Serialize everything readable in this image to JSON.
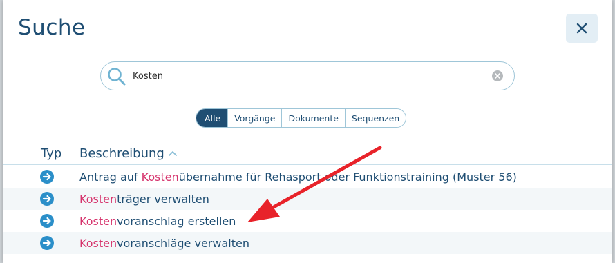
{
  "dialog": {
    "title": "Suche",
    "close_icon": "close-icon"
  },
  "search": {
    "value": "Kosten",
    "search_icon": "search-icon",
    "clear_icon": "clear-icon"
  },
  "filters": [
    {
      "label": "Alle",
      "active": true
    },
    {
      "label": "Vorgänge",
      "active": false
    },
    {
      "label": "Dokumente",
      "active": false
    },
    {
      "label": "Sequenzen",
      "active": false
    }
  ],
  "table": {
    "columns": [
      "Typ",
      "Beschreibung"
    ],
    "sort_icon": "chevron-up-icon",
    "highlight": "Kosten",
    "rows": [
      {
        "icon": "arrow-right-circle-icon",
        "match": "Kosten",
        "rest": "übernahme für Rehasport oder Funktionstraining (Muster 56)",
        "prefix": "Antrag auf "
      },
      {
        "icon": "arrow-right-circle-icon",
        "match": "Kosten",
        "rest": "träger verwalten",
        "prefix": ""
      },
      {
        "icon": "arrow-right-circle-icon",
        "match": "Kosten",
        "rest": "voranschlag erstellen",
        "prefix": ""
      },
      {
        "icon": "arrow-right-circle-icon",
        "match": "Kosten",
        "rest": "voranschläge verwalten",
        "prefix": ""
      }
    ]
  },
  "colors": {
    "primary": "#1f4e73",
    "highlight": "#d6336c",
    "row_icon": "#2b8fc9",
    "annotation_arrow": "#e8232a"
  }
}
